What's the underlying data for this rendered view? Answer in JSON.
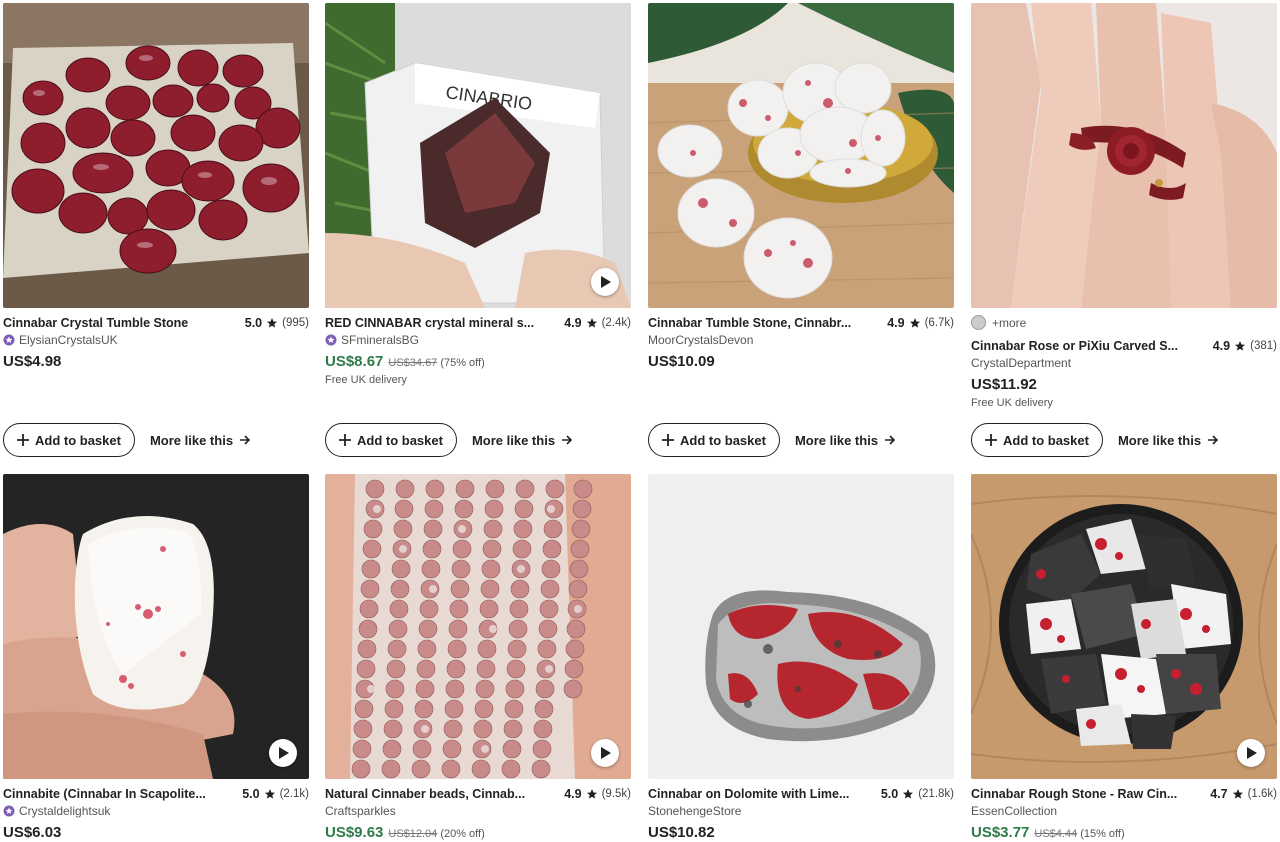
{
  "listings": [
    {
      "title": "Cinnabar Crystal Tumble Stone",
      "rating": "5.0",
      "reviews": "(995)",
      "seller": "ElysianCrystalsUK",
      "star_seller": true,
      "price": "US$4.98"
    },
    {
      "title": "RED CINNABAR crystal mineral s...",
      "rating": "4.9",
      "reviews": "(2.4k)",
      "seller": "SFmineralsBG",
      "star_seller": true,
      "price": "US$8.67",
      "original_price": "US$34.67",
      "discount": "(75% off)",
      "delivery": "Free UK delivery",
      "box_label": "CINABRIO"
    },
    {
      "title": "Cinnabar Tumble Stone, Cinnabr...",
      "rating": "4.9",
      "reviews": "(6.7k)",
      "seller": "MoorCrystalsDevon",
      "price": "US$10.09"
    },
    {
      "title": "Cinnabar Rose or PiXiu Carved S...",
      "rating": "4.9",
      "reviews": "(381)",
      "seller": "CrystalDepartment",
      "price": "US$11.92",
      "delivery": "Free UK delivery",
      "variants_label": "+more"
    },
    {
      "title": "Cinnabite (Cinnabar In Scapolite...",
      "rating": "5.0",
      "reviews": "(2.1k)",
      "seller": "Crystaldelightsuk",
      "star_seller": true,
      "price": "US$6.03"
    },
    {
      "title": "Natural Cinnaber beads, Cinnab...",
      "rating": "4.9",
      "reviews": "(9.5k)",
      "seller": "Craftsparkles",
      "price": "US$9.63",
      "original_price": "US$12.04",
      "discount": "(20% off)"
    },
    {
      "title": "Cinnabar on Dolomite with Lime...",
      "rating": "5.0",
      "reviews": "(21.8k)",
      "seller": "StonehengeStore",
      "price": "US$10.82"
    },
    {
      "title": "Cinnabar Rough Stone - Raw Cin...",
      "rating": "4.7",
      "reviews": "(1.6k)",
      "seller": "EssenCollection",
      "price": "US$3.77",
      "original_price": "US$4.44",
      "discount": "(15% off)"
    }
  ],
  "actions": {
    "add_label": "Add to basket",
    "more_label": "More like this"
  },
  "colors": {
    "sale_green": "#2f7a4a",
    "star_seller_purple": "#7c5fb8",
    "text": "#222222"
  }
}
